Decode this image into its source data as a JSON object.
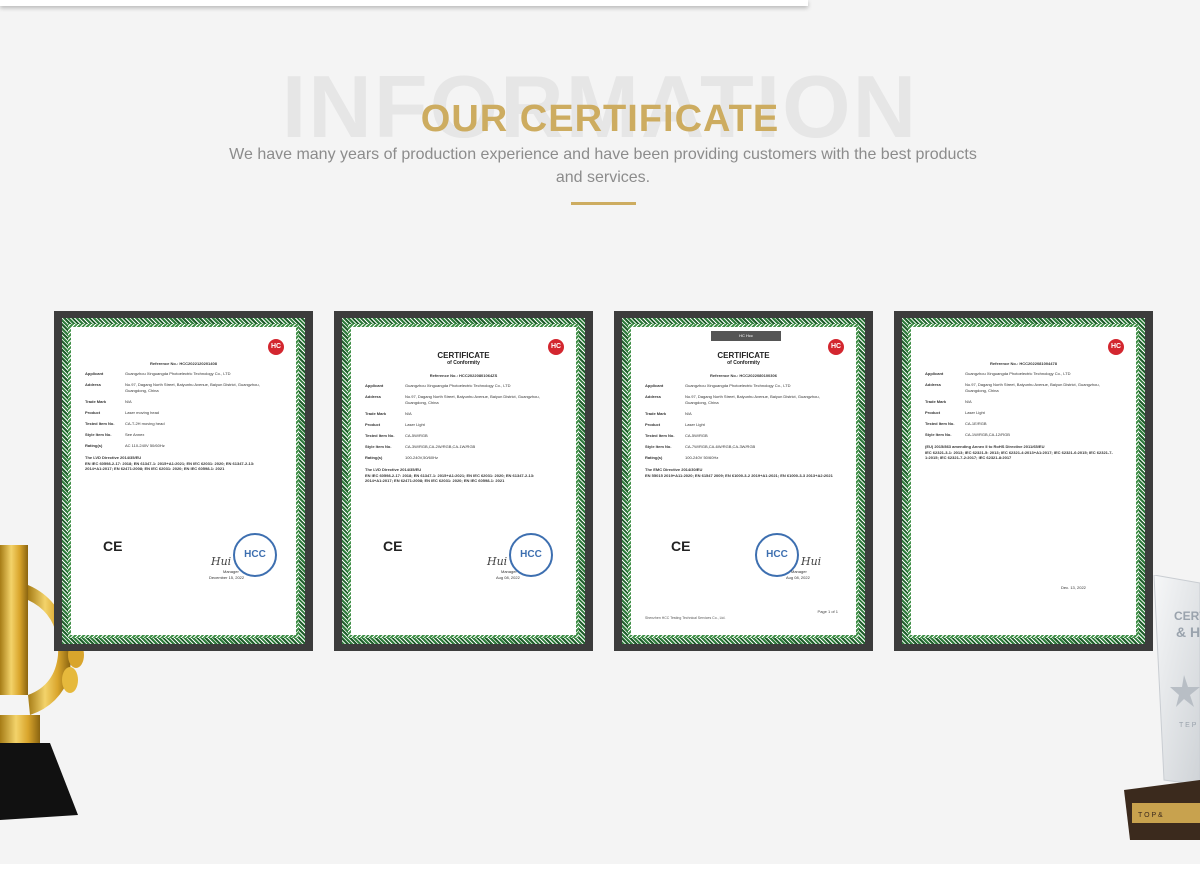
{
  "section": {
    "bg_word": "INFORMATION",
    "title": "OUR CERTIFICATE",
    "subtitle": "We have many years of production experience and have been providing customers with the best products and services."
  },
  "colors": {
    "accent_gold": "#cdac60",
    "bg_word": "#e6e6e6",
    "subtitle": "#8c8c8c",
    "frame_green": "#2d7a3a",
    "frame_dark": "#3c3c3c",
    "hc_red": "#d3262f",
    "stamp_blue": "#3d6fb0"
  },
  "certificates": [
    {
      "logo": "HC",
      "doc_title": "",
      "doc_sub": "",
      "ref": "Reference No.: HCC2022120201408",
      "fields": [
        {
          "k": "Applicant",
          "v": "Guangzhou Xinguangda Photoelectric Technology Co., LTD"
        },
        {
          "k": "Address",
          "v": "No.97, Dagang North Street, Baiyunhu Avenue, Baiyun District, Guangzhou, Guangdong, China"
        },
        {
          "k": "Trade Mark",
          "v": "N/A"
        },
        {
          "k": "Product",
          "v": "Laser moving head"
        },
        {
          "k": "Tested Item No.",
          "v": "CA-T-2H moving head"
        },
        {
          "k": "Style Item No.",
          "v": "See Annex"
        },
        {
          "k": "Rating(s)",
          "v": "AC 110-240V 50/60Hz"
        }
      ],
      "directive": "The LVD Directive 2014/35/EU",
      "standards": "EN IEC 60598-2-17: 2018; EN 61347-1: 2015+A1:2021; EN IEC 62031: 2020; EN 61347-2-13: 2014+A1:2017; EN 62471:2008; EN IEC 62031: 2020; EN IEC 60598-1: 2021",
      "ce": "CE",
      "stamp": "HCC",
      "signature": "Hui",
      "manager": "Manager",
      "date": "December 15, 2022",
      "footer": "",
      "page": "",
      "tab": ""
    },
    {
      "logo": "HC",
      "doc_title": "CERTIFICATE",
      "doc_sub": "of Conformity",
      "ref": "Reference No.: HCC20220801064ZS",
      "fields": [
        {
          "k": "Applicant",
          "v": "Guangzhou Xinguangda Photoelectric Technology Co., LTD"
        },
        {
          "k": "Address",
          "v": "No.97, Dagang North Street, Baiyunhu Avenue, Baiyun District, Guangzhou, Guangdong, China"
        },
        {
          "k": "Trade Mark",
          "v": "N/A"
        },
        {
          "k": "Product",
          "v": "Laser Light"
        },
        {
          "k": "Tested Item No.",
          "v": "CA-5W/RGB"
        },
        {
          "k": "Style Item No.",
          "v": "CA-3W/RGB,CA-2W/RGB,CA-1W/RGB"
        },
        {
          "k": "Rating(s)",
          "v": "100-240V,50/60Hz"
        }
      ],
      "directive": "The LVD Directive 2014/35/EU",
      "standards": "EN IEC 60598-2-17: 2018; EN 61347-1: 2015+A1:2021; EN IEC 62031: 2020; EN 61347-2-13: 2014+A1:2017; EN 62471:2008; EN IEC 62031: 2020; EN IEC 60598-1: 2021",
      "ce": "CE",
      "stamp": "HCC",
      "signature": "Hui",
      "manager": "Manager",
      "date": "Aug 08, 2022",
      "footer": "",
      "page": "",
      "tab": ""
    },
    {
      "logo": "HC",
      "doc_title": "CERTIFICATE",
      "doc_sub": "of Conformity",
      "ref": "Reference No.: HCC2022080100306",
      "fields": [
        {
          "k": "Applicant",
          "v": "Guangzhou Xinguangda Photoelectric Technology Co., LTD"
        },
        {
          "k": "Address",
          "v": "No.97, Dagang North Street, Baiyunhu Avenue, Baiyun District, Guangzhou, Guangdong, China"
        },
        {
          "k": "Trade Mark",
          "v": "N/A"
        },
        {
          "k": "Product",
          "v": "Laser Light"
        },
        {
          "k": "Tested Item No.",
          "v": "CA-5W/RGB"
        },
        {
          "k": "Style Item No.",
          "v": "CA-7W/RGB,CA-6W/RGB,CA-3W/RGB"
        },
        {
          "k": "Rating(s)",
          "v": "100-240V 50/60Hz"
        }
      ],
      "directive": "The EMC Directive 2014/30/EU",
      "standards": "EN 55015 2019+A11:2020; EN 61547 2009; EN 61000-3-2 2019+A1:2021; EN 61000-3-3 2013+A2:2021",
      "ce": "CE",
      "stamp": "HCC",
      "signature": "Hui",
      "manager": "Manager",
      "date": "Aug 08, 2022",
      "footer": "Shenzhen HCC Testing Technical Services Co., Ltd.",
      "page": "Page 1 of 1",
      "tab": "HC  Hcc"
    },
    {
      "logo": "HC",
      "doc_title": "",
      "doc_sub": "",
      "ref": "Reference No.: HCC2022081004478",
      "fields": [
        {
          "k": "Applicant",
          "v": "Guangzhou Xinguangda Photoelectric Technology Co., LTD"
        },
        {
          "k": "Address",
          "v": "No.97, Dagang North Street, Baiyunhu Avenue, Baiyun District, Guangzhou, Guangdong, China"
        },
        {
          "k": "Trade Mark",
          "v": "N/A"
        },
        {
          "k": "Product",
          "v": "Laser Light"
        },
        {
          "k": "Tested Item No.",
          "v": "CA-1E/RGB"
        },
        {
          "k": "Style Item No.",
          "v": "CA-1W/RGB,CA-12/RGB"
        }
      ],
      "directive": "(EU) 2015/863 amending Annex II to RoHS Directive 2011/65/EU",
      "standards": "IEC 62321-3-1: 2013; IEC 62321-5: 2013; IEC 62321-4:2013+A1:2017; IEC 62321-6:2015; IEC 62321-7-1:2015; IEC 62321-7-2:2017; IEC 62321-8:2017",
      "ce": "",
      "stamp": "",
      "signature": "",
      "manager": "",
      "date": "Dec. 13, 2022",
      "footer": "",
      "page": "",
      "tab": ""
    }
  ],
  "trophy_right_text": [
    "CERT",
    "& H",
    "T E P",
    "T O P  &"
  ]
}
